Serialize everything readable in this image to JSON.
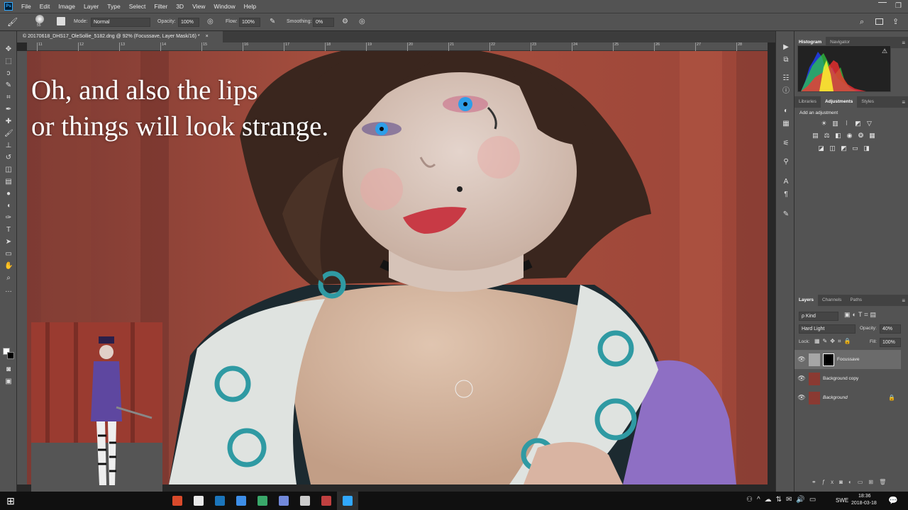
{
  "app": {
    "logo_text": "Ps"
  },
  "menu": [
    "File",
    "Edit",
    "Image",
    "Layer",
    "Type",
    "Select",
    "Filter",
    "3D",
    "View",
    "Window",
    "Help"
  ],
  "options": {
    "brush_size": "55",
    "mode_label": "Mode:",
    "mode_value": "Normal",
    "opacity_label": "Opacity:",
    "opacity_value": "100%",
    "flow_label": "Flow:",
    "flow_value": "100%",
    "smoothing_label": "Smoothing:",
    "smoothing_value": "0%"
  },
  "document": {
    "tab_title": "© 20170618_DHS17_OleSollie_5182.dng @ 92% (Focussave, Layer Mask/16) *",
    "close_glyph": "×"
  },
  "ruler": {
    "h_ticks": [
      "11",
      "12",
      "13",
      "14",
      "15",
      "16",
      "17",
      "18",
      "19",
      "20",
      "21",
      "22",
      "23",
      "24",
      "25",
      "26",
      "27",
      "28"
    ]
  },
  "canvas": {
    "overlay_line1": "Oh, and also the lips",
    "overlay_line2": "or things will look strange."
  },
  "panels": {
    "top_tabs": [
      "Histogram",
      "Navigator"
    ],
    "mid_tabs": [
      "Libraries",
      "Adjustments",
      "Styles"
    ],
    "add_adjustment": "Add an adjustment",
    "layers_tabs": [
      "Layers",
      "Channels",
      "Paths"
    ],
    "kind_label": "ρ Kind",
    "blend_mode": "Hard Light",
    "opacity_label": "Opacity:",
    "opacity_value": "40%",
    "lock_label": "Lock:",
    "fill_label": "Fill:",
    "fill_value": "100%"
  },
  "layers": [
    {
      "name": "Focussave",
      "selected": true,
      "italic": false,
      "thumb_color": "#a6a6a6"
    },
    {
      "name": "Background copy",
      "selected": false,
      "italic": false,
      "thumb_color": "#8a3a32"
    },
    {
      "name": "Background",
      "selected": false,
      "italic": true,
      "thumb_color": "#8a3a32"
    }
  ],
  "taskbar": {
    "lang": "SWE",
    "time": "18:36",
    "date": "2018-03-18",
    "apps": [
      {
        "icon": "chrome-icon",
        "color": "#d94a2b"
      },
      {
        "icon": "store-icon",
        "color": "#e8e8e8"
      },
      {
        "icon": "steam-icon",
        "color": "#1b75bb"
      },
      {
        "icon": "lightroom-icon",
        "color": "#3d8ee8"
      },
      {
        "icon": "gamepad-icon",
        "color": "#39a86a"
      },
      {
        "icon": "discord-icon",
        "color": "#7289da"
      },
      {
        "icon": "clock-icon",
        "color": "#cccccc"
      },
      {
        "icon": "movie-icon",
        "color": "#c04040"
      },
      {
        "icon": "photoshop-icon",
        "color": "#31a8ff"
      }
    ]
  },
  "colors": {
    "accent": "#31a8ff",
    "panel": "#535353",
    "canvas_bg": "#a84a3c"
  }
}
